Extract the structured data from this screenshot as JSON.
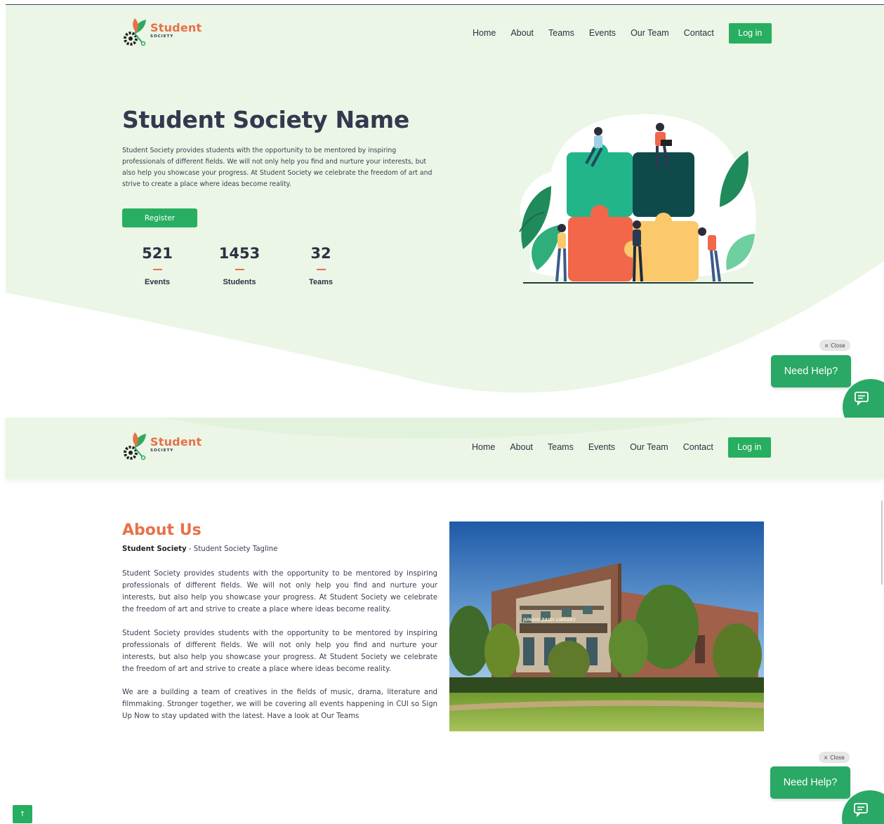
{
  "brand": {
    "name": "Student",
    "sub": "SOCIETY"
  },
  "nav": {
    "items": [
      "Home",
      "About",
      "Teams",
      "Events",
      "Our Team",
      "Contact"
    ],
    "login": "Log in"
  },
  "hero": {
    "title": "Student Society Name",
    "description": "Student Society provides students with the opportunity to be mentored by inspiring professionals of different fields. We will not only help you find and nurture your interests, but also help you showcase your progress. At Student Society we celebrate the freedom of art and strive to create a place where ideas become reality.",
    "register": "Register",
    "stats": [
      {
        "value": "521",
        "label": "Events"
      },
      {
        "value": "1453",
        "label": "Students"
      },
      {
        "value": "32",
        "label": "Teams"
      }
    ]
  },
  "help": {
    "close_label": "Close",
    "close_icon": "×",
    "button": "Need Help?"
  },
  "about": {
    "title": "About Us",
    "tagline_strong": "Student Society",
    "tagline_rest": " - Student Society Tagline",
    "paragraphs": [
      "Student Society provides students with the opportunity to be mentored by inspiring professionals of different fields. We will not only help you find and nurture your interests, but also help you showcase your progress. At Student Society we celebrate the freedom of art and strive to create a place where ideas become reality.",
      "Student Society provides students with the opportunity to be mentored by inspiring professionals of different fields. We will not only help you find and nurture your interests, but also help you showcase your progress. At Student Society we celebrate the freedom of art and strive to create a place where ideas become reality.",
      "We are a building a team of creatives in the fields of music, drama, literature and filmmaking. Stronger together, we will be covering all events happening in CUI so Sign Up Now to stay updated with the latest. Have a look at Our Teams"
    ],
    "image_sign": "JUNAID ZAIDI LIBRARY"
  },
  "scroll_top": "↑",
  "colors": {
    "accent": "#27ae60",
    "brand_orange": "#e8704a",
    "hero_bg": "#ebf6e6",
    "text_dark": "#2d3144"
  }
}
